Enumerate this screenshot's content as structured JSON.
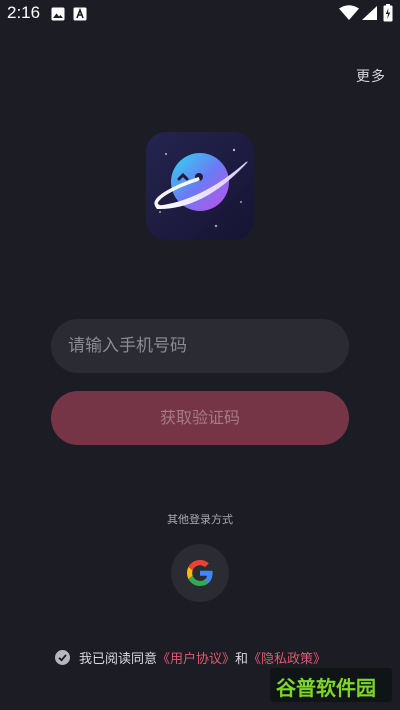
{
  "status_bar": {
    "time": "2:16",
    "icons": [
      "image-icon",
      "a-notification-icon",
      "wifi-icon",
      "signal-icon",
      "battery-icon"
    ]
  },
  "header": {
    "more_label": "更多"
  },
  "app_icon": {
    "name": "planet-app-icon"
  },
  "login": {
    "phone_placeholder": "请输入手机号码",
    "phone_value": "",
    "get_code_label": "获取验证码"
  },
  "other_login": {
    "title": "其他登录方式",
    "google_icon": "google-icon"
  },
  "agreement": {
    "prefix": "我已阅读同意",
    "user_agreement": "《用户协议》",
    "and": "和",
    "privacy_policy": "《隐私政策》",
    "checked": true
  },
  "watermark": {
    "text": "谷普软件园"
  },
  "colors": {
    "background": "#1c1c25",
    "input_bg": "#2b2b33",
    "button_bg": "#763447",
    "link": "#e2586f",
    "watermark_green": "#7fd62a"
  }
}
